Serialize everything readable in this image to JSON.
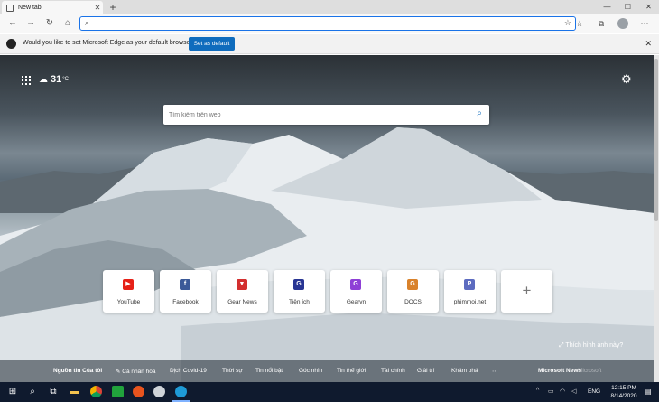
{
  "browser": {
    "tab_title": "New tab",
    "new_tab_symbol": "+",
    "tab_close": "✕",
    "window_controls": [
      "—",
      "☐",
      "✕"
    ],
    "address_value": "",
    "nav": {
      "back": "←",
      "forward": "→",
      "refresh": "↻",
      "home": "⌂"
    }
  },
  "infobar": {
    "message": "Would you like to set Microsoft Edge as your default browser?",
    "button": "Set as default",
    "close": "✕"
  },
  "newtab": {
    "temperature": "31",
    "temperature_unit": "°C",
    "search_placeholder": "Tìm kiếm trên web",
    "tiles": [
      {
        "label": "YouTube",
        "icon": "youtube-icon",
        "glyph": "▶",
        "color": "#e62117"
      },
      {
        "label": "Facebook",
        "icon": "facebook-icon",
        "glyph": "f",
        "color": "#3b5998"
      },
      {
        "label": "Gear News",
        "icon": "gearnews-icon",
        "glyph": "▼",
        "color": "#d32f2f"
      },
      {
        "label": "Tiện ích",
        "icon": "tienich-icon",
        "glyph": "G",
        "color": "#283593"
      },
      {
        "label": "Gearvn",
        "icon": "gearvn-icon",
        "glyph": "G",
        "color": "#8e3fd6"
      },
      {
        "label": "DOCS",
        "icon": "docs-icon",
        "glyph": "G",
        "color": "#d9822b"
      },
      {
        "label": "phimmoi.net",
        "icon": "phimmoi-icon",
        "glyph": "P",
        "color": "#5c6bc0"
      }
    ],
    "add_tile_symbol": "+",
    "like_image_link": "Thích hình ảnh này?",
    "news_tabs": [
      "Nguồn tin Của tôi",
      "Cá nhân hóa",
      "Dịch Covid-19",
      "Thời sự",
      "Tin nổi bật",
      "Góc nhìn",
      "Tin thế giới",
      "Tài chính",
      "Giải trí",
      "Khám phá"
    ],
    "news_provider": "Microsoft News",
    "news_provider_sub": "Microsoft"
  },
  "taskbar": {
    "language": "ENG",
    "time": "12:15 PM",
    "date": "8/14/2020"
  }
}
